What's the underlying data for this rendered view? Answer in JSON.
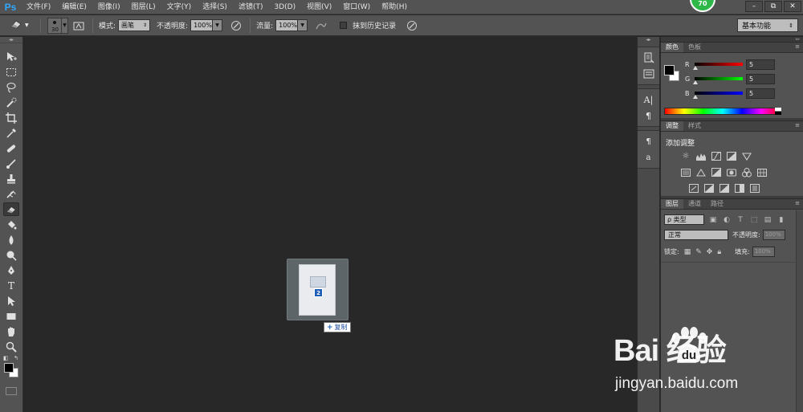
{
  "app": {
    "logo": "Ps"
  },
  "menu": {
    "items": [
      "文件(F)",
      "编辑(E)",
      "图像(I)",
      "图层(L)",
      "文字(Y)",
      "选择(S)",
      "滤镜(T)",
      "3D(D)",
      "视图(V)",
      "窗口(W)",
      "帮助(H)"
    ]
  },
  "badge": {
    "score": "70",
    "color": "#2eb84a"
  },
  "window_controls": {
    "minimize": "–",
    "restore": "⧉",
    "close": "✕"
  },
  "options_bar": {
    "brush_size": "30",
    "mode_label": "模式:",
    "mode_value": "画笔",
    "opacity_label": "不透明度:",
    "opacity_value": "100%",
    "flow_label": "流量:",
    "flow_value": "100%",
    "erase_history_label": "抹到历史记录",
    "workspace": "基本功能"
  },
  "drag_preview": {
    "count": "2",
    "copy_label": "复制"
  },
  "color_panel": {
    "tabs": [
      "颜色",
      "色板"
    ],
    "channels": [
      {
        "label": "R",
        "value": "5",
        "gradient": "linear-gradient(to right, #000000, #ff0000)"
      },
      {
        "label": "G",
        "value": "5",
        "gradient": "linear-gradient(to right, #000000, #00ff00)"
      },
      {
        "label": "B",
        "value": "5",
        "gradient": "linear-gradient(to right, #000000, #0000ff)"
      }
    ],
    "foreground": "#050505",
    "background": "#ffffff"
  },
  "adjustments_panel": {
    "tabs": [
      "调整",
      "样式"
    ],
    "title": "添加调整"
  },
  "layers_panel": {
    "tabs": [
      "图层",
      "通道",
      "路径"
    ],
    "filter_label": "ρ 类型",
    "blend_mode": "正常",
    "opacity_label": "不透明度:",
    "opacity_value": "100%",
    "lock_label": "锁定:",
    "fill_label": "填充:",
    "fill_value": "100%"
  },
  "watermark": {
    "brand": "Bai   经验",
    "url": "jingyan.baidu.com"
  }
}
